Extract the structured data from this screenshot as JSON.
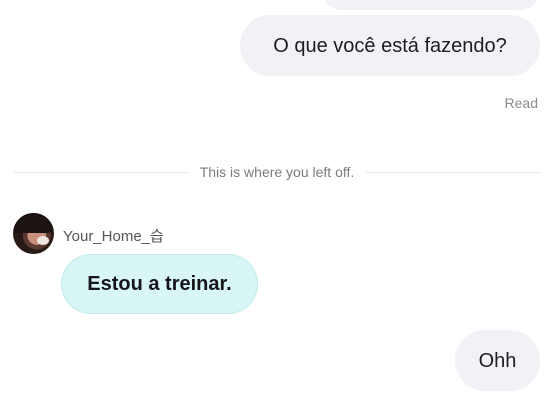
{
  "messages": {
    "outgoing_question": "O que você está fazendo?",
    "read_status": "Read",
    "divider_text": "This is where you left off.",
    "incoming": {
      "username": "Your_Home_습",
      "text": "Estou a treinar."
    },
    "outgoing_reply": "Ohh"
  },
  "colors": {
    "outgoing_bubble": "#f1f2f6",
    "incoming_bubble": "#d8f6f6",
    "divider_text": "#7a7a80"
  }
}
